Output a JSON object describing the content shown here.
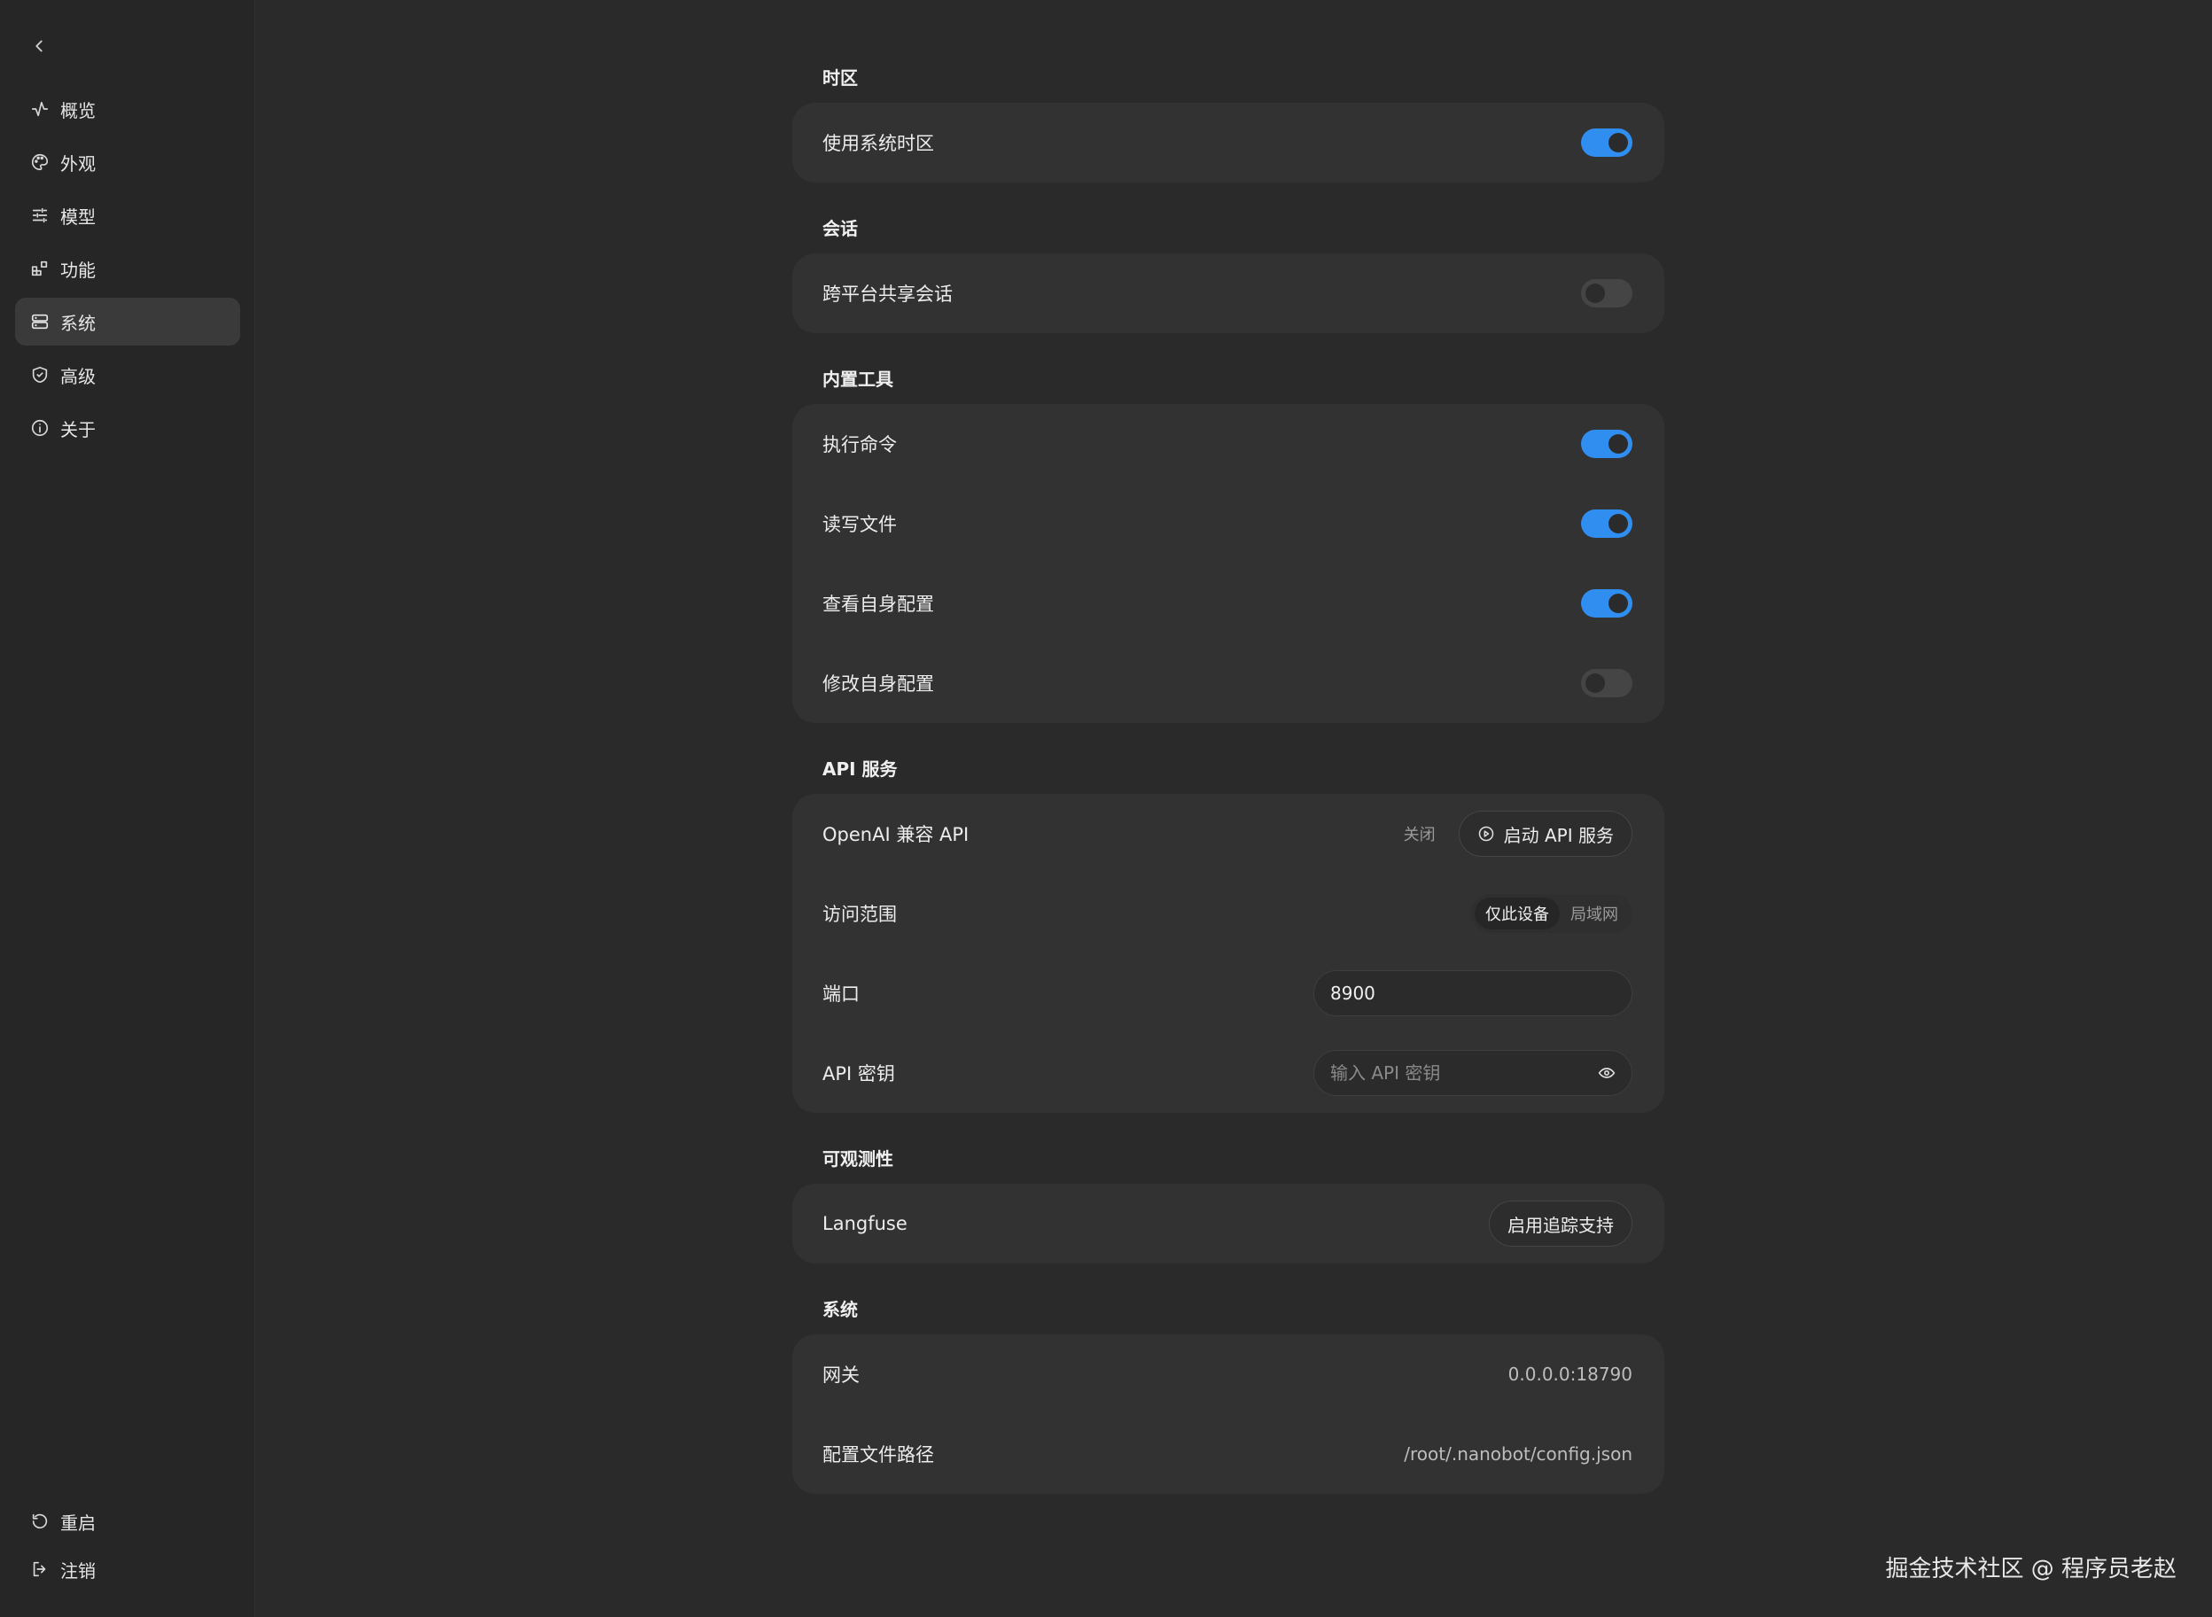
{
  "sidebar": {
    "back_icon": "chevron-left-icon",
    "items": [
      {
        "label": "概览",
        "icon": "activity-icon"
      },
      {
        "label": "外观",
        "icon": "palette-icon"
      },
      {
        "label": "模型",
        "icon": "sliders-icon"
      },
      {
        "label": "功能",
        "icon": "blocks-icon"
      },
      {
        "label": "系统",
        "icon": "server-icon",
        "active": true
      },
      {
        "label": "高级",
        "icon": "shield-icon"
      },
      {
        "label": "关于",
        "icon": "info-icon"
      }
    ],
    "bottom": [
      {
        "label": "重启",
        "icon": "restart-icon"
      },
      {
        "label": "注销",
        "icon": "logout-icon"
      }
    ]
  },
  "sections": {
    "timezone": {
      "title": "时区",
      "use_system_timezone": {
        "label": "使用系统时区",
        "enabled": true
      }
    },
    "session": {
      "title": "会话",
      "cross_platform_share": {
        "label": "跨平台共享会话",
        "enabled": false
      }
    },
    "builtin_tools": {
      "title": "内置工具",
      "exec_command": {
        "label": "执行命令",
        "enabled": true
      },
      "read_write_files": {
        "label": "读写文件",
        "enabled": true
      },
      "view_self_config": {
        "label": "查看自身配置",
        "enabled": true
      },
      "modify_self_config": {
        "label": "修改自身配置",
        "enabled": false
      }
    },
    "api_service": {
      "title": "API 服务",
      "openai_api": {
        "label": "OpenAI 兼容 API",
        "status": "关闭",
        "start_button": "启动 API 服务"
      },
      "access_scope": {
        "label": "访问范围",
        "options": [
          "仅此设备",
          "局域网"
        ],
        "selected": "仅此设备"
      },
      "port": {
        "label": "端口",
        "value": "8900"
      },
      "api_key": {
        "label": "API 密钥",
        "placeholder": "输入 API 密钥"
      }
    },
    "observability": {
      "title": "可观测性",
      "langfuse": {
        "label": "Langfuse",
        "button": "启用追踪支持"
      }
    },
    "system": {
      "title": "系统",
      "gateway": {
        "label": "网关",
        "value": "0.0.0.0:18790"
      },
      "config_path": {
        "label": "配置文件路径",
        "value": "/root/.nanobot/config.json"
      }
    }
  },
  "watermark": "掘金技术社区 @ 程序员老赵",
  "colors": {
    "accent": "#2f8ef0",
    "background": "#2a2a2a",
    "card": "#323232",
    "sidebar": "#262626"
  }
}
